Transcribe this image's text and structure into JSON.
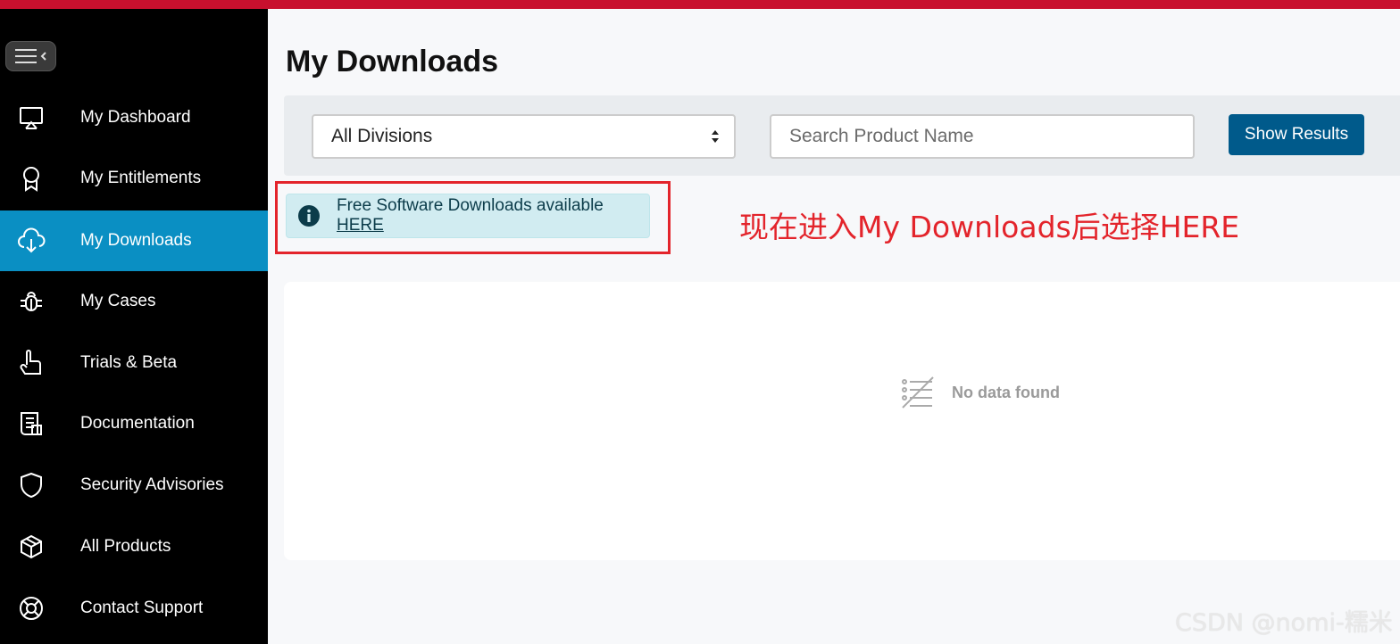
{
  "colors": {
    "topbar": "#c8102e",
    "sidebar_bg": "#000000",
    "active_item": "#0a8fc3",
    "primary_button": "#005a8b",
    "annotation": "#e3242b",
    "alert_bg": "#d1ecf1"
  },
  "sidebar": {
    "toggle_icon": "menu-collapse-icon",
    "items": [
      {
        "label": "My Dashboard",
        "icon": "monitor-icon",
        "active": false
      },
      {
        "label": "My Entitlements",
        "icon": "award-icon",
        "active": false
      },
      {
        "label": "My Downloads",
        "icon": "cloud-download-icon",
        "active": true
      },
      {
        "label": "My Cases",
        "icon": "bug-icon",
        "active": false
      },
      {
        "label": "Trials & Beta",
        "icon": "pointer-hand-icon",
        "active": false
      },
      {
        "label": "Documentation",
        "icon": "document-icon",
        "active": false
      },
      {
        "label": "Security Advisories",
        "icon": "shield-icon",
        "active": false
      },
      {
        "label": "All Products",
        "icon": "cube-icon",
        "active": false
      },
      {
        "label": "Contact Support",
        "icon": "lifebuoy-icon",
        "active": false
      }
    ]
  },
  "main": {
    "title": "My Downloads",
    "filter": {
      "division_selected": "All Divisions",
      "search_placeholder": "Search Product Name",
      "search_value": "",
      "show_results": "Show Results"
    },
    "alert": {
      "text": "Free Software Downloads available ",
      "link": "HERE"
    },
    "annotation": "现在进入My Downloads后选择HERE",
    "empty_state": "No data found"
  },
  "watermark": "CSDN @nomi-糯米"
}
